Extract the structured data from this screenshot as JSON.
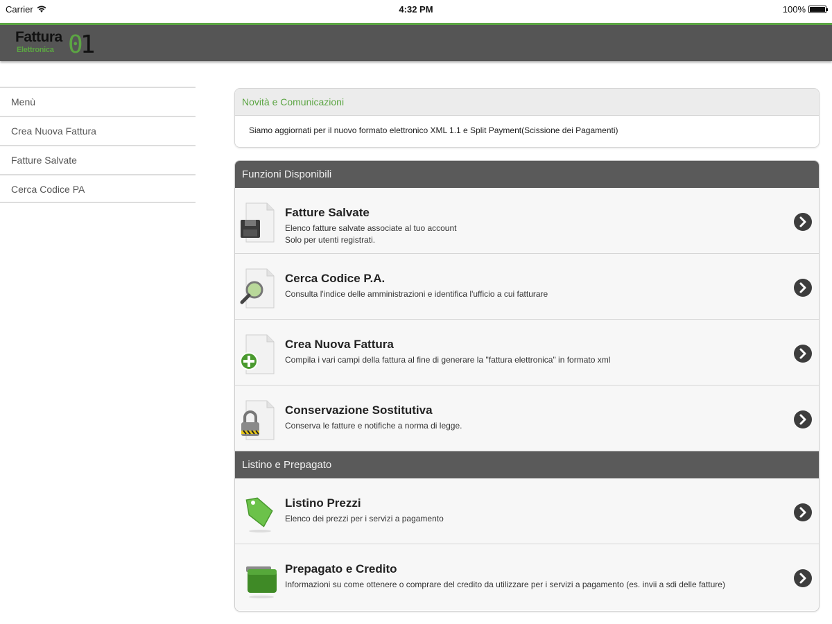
{
  "status": {
    "carrier": "Carrier",
    "time": "4:32 PM",
    "battery": "100%"
  },
  "logo": {
    "line1": "Fattura",
    "line2": "Elettronica",
    "num_green": "0",
    "num_dark": "1"
  },
  "sidebar": {
    "items": [
      {
        "label": "Menù"
      },
      {
        "label": "Crea Nuova Fattura"
      },
      {
        "label": "Fatture Salvate"
      },
      {
        "label": "Cerca Codice PA"
      }
    ]
  },
  "news": {
    "title": "Novità e Comunicazioni",
    "text": "Siamo aggiornati per il nuovo formato elettronico XML 1.1 e Split Payment(Scissione dei Pagamenti)"
  },
  "functions": {
    "heading": "Funzioni Disponibili",
    "items": [
      {
        "title": "Fatture Salvate",
        "desc1": "Elenco fatture salvate associate al tuo account",
        "desc2": "Solo per utenti registrati.",
        "icon": "saved-document-icon"
      },
      {
        "title": "Cerca Codice P.A.",
        "desc1": "Consulta l'indice delle amministrazioni e identifica l'ufficio a cui fatturare",
        "icon": "search-document-icon"
      },
      {
        "title": "Crea Nuova Fattura",
        "desc1": "Compila i vari campi della fattura al fine di generare la \"fattura elettronica\" in formato xml",
        "icon": "add-document-icon"
      },
      {
        "title": "Conservazione Sostitutiva",
        "desc1": "Conserva le fatture e notifiche a norma di legge.",
        "icon": "lock-document-icon"
      }
    ]
  },
  "pricing": {
    "heading": "Listino e Prepagato",
    "items": [
      {
        "title": "Listino Prezzi",
        "desc1": "Elenco dei prezzi per i servizi a pagamento",
        "icon": "price-tag-icon"
      },
      {
        "title": "Prepagato e Credito",
        "desc1": "Informazioni su come ottenere o comprare del credito da utilizzare per i servizi a pagamento (es. invii a sdi delle fatture)",
        "icon": "wallet-icon"
      }
    ]
  },
  "colors": {
    "accent": "#5ca543",
    "navbar": "#555555",
    "section_head": "#5a5a5a"
  }
}
